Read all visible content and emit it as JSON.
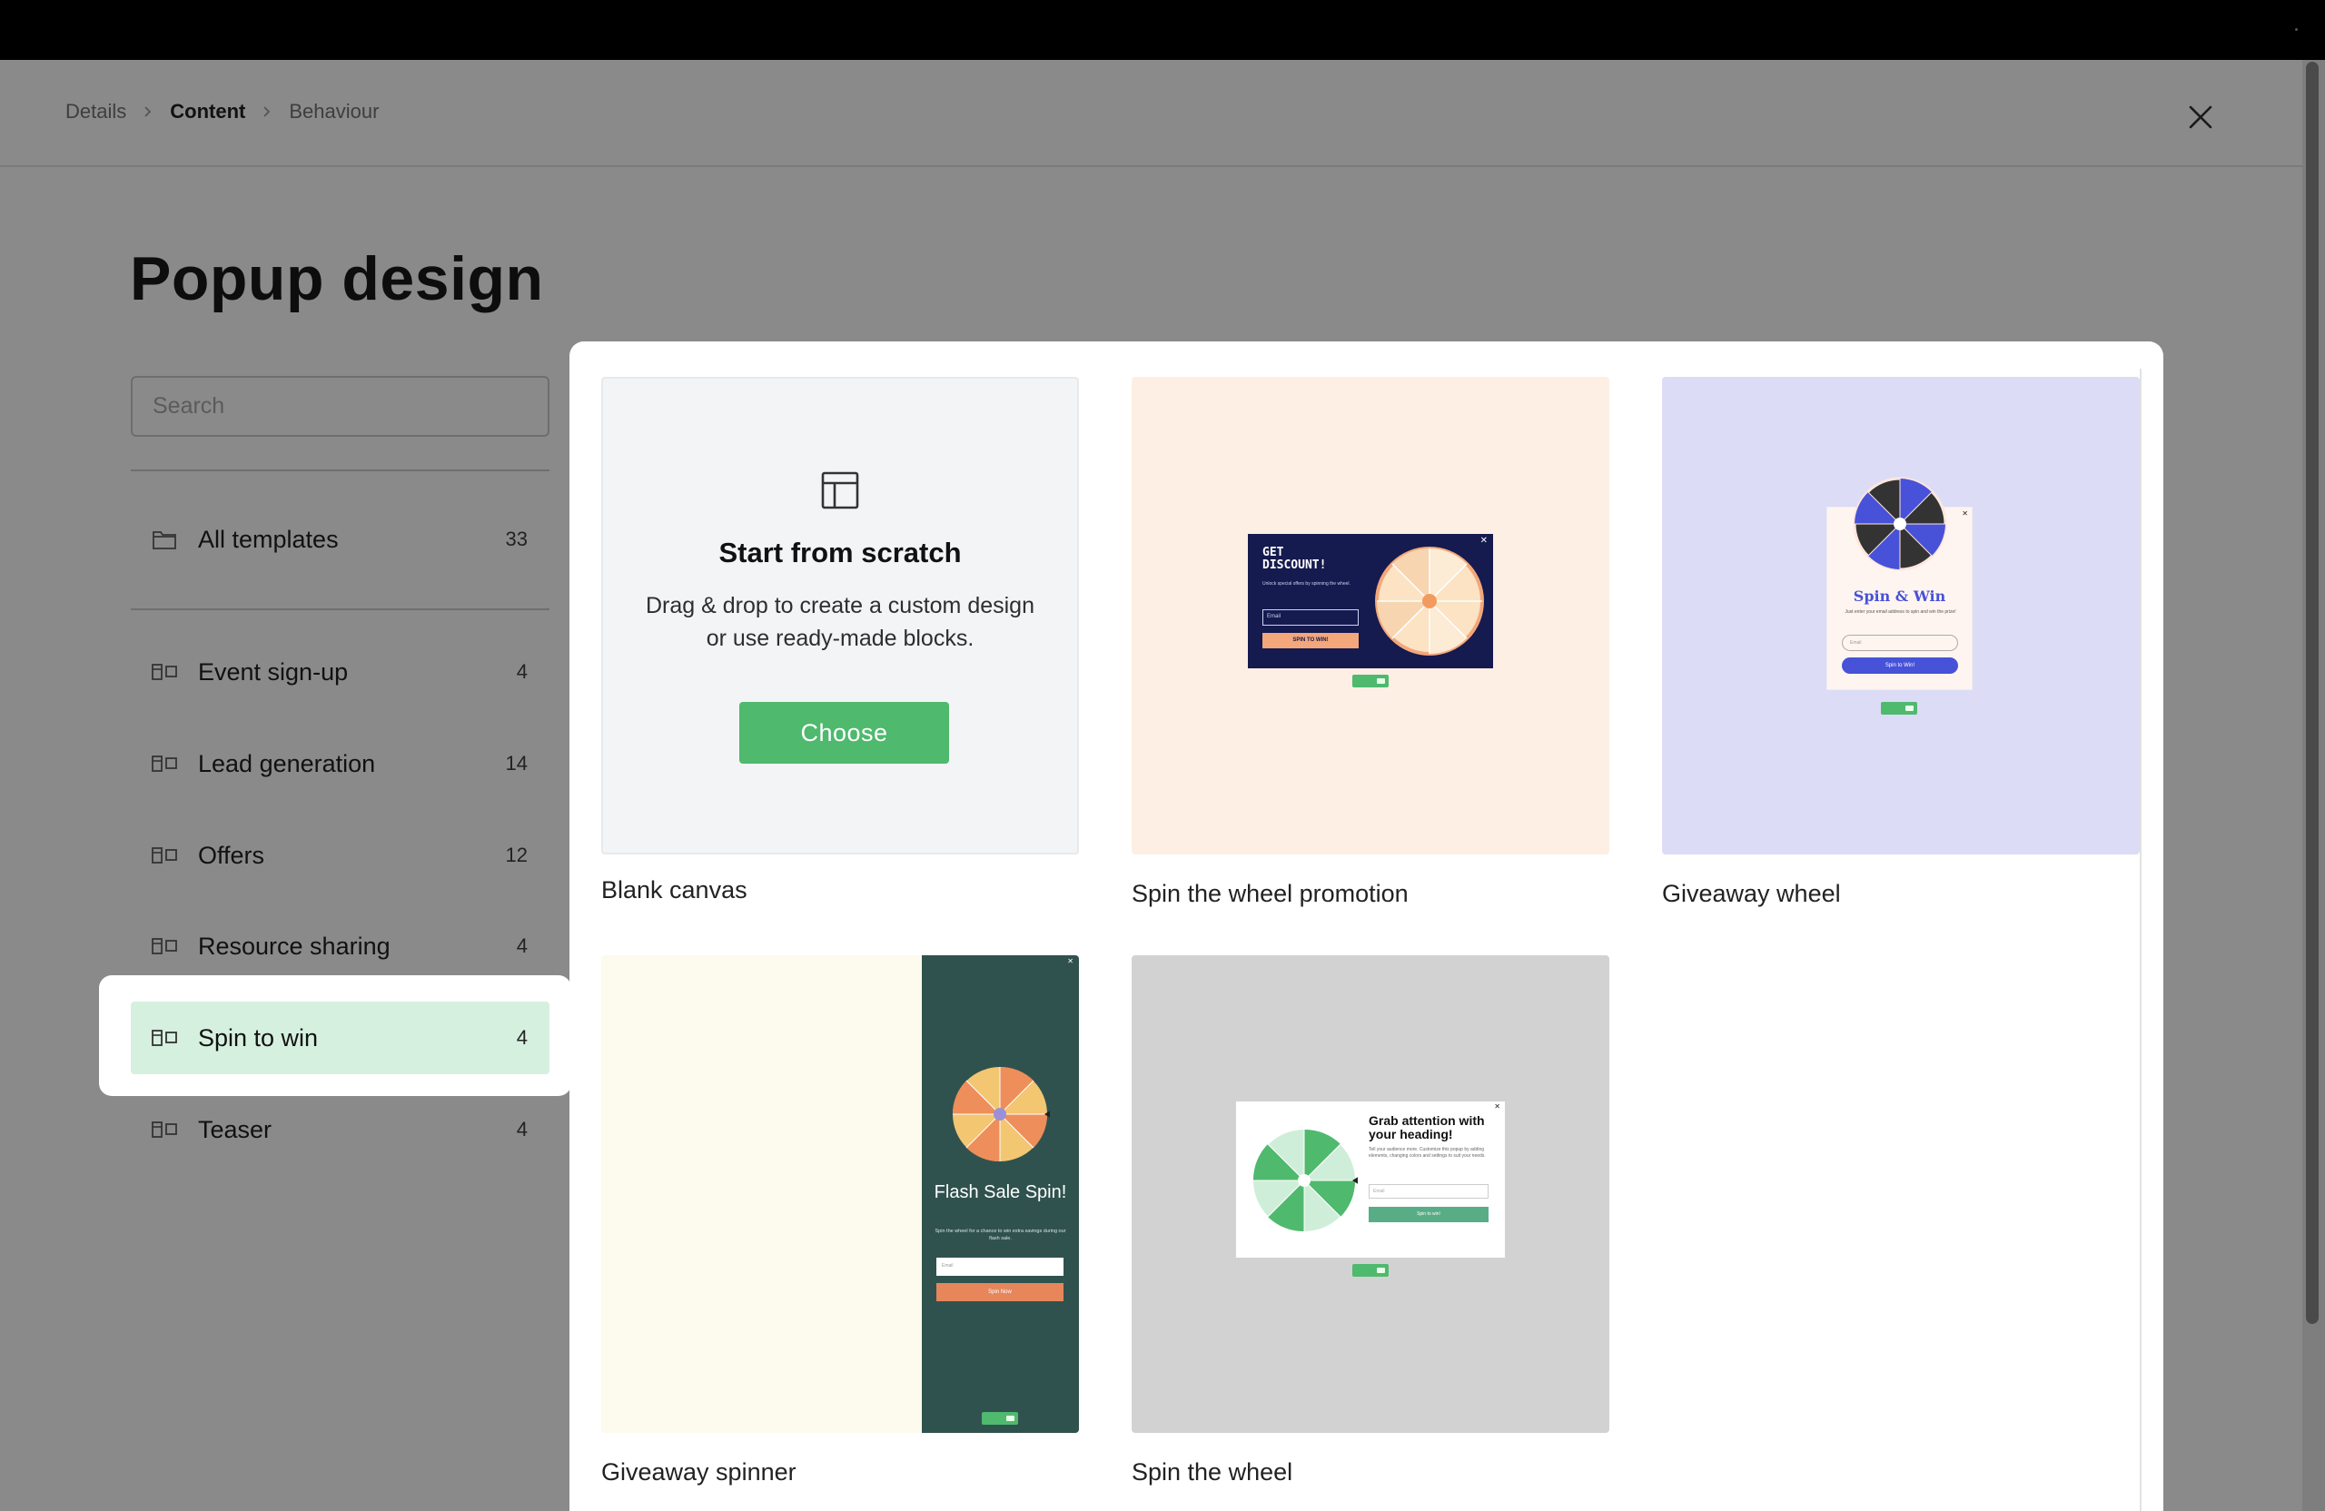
{
  "breadcrumb": {
    "items": [
      {
        "label": "Details",
        "active": false
      },
      {
        "label": "Content",
        "active": true
      },
      {
        "label": "Behaviour",
        "active": false
      }
    ]
  },
  "page": {
    "title": "Popup design"
  },
  "search": {
    "placeholder": "Search",
    "value": ""
  },
  "sidebar": {
    "all": {
      "label": "All templates",
      "count": "33",
      "icon": "folder-icon"
    },
    "categories": [
      {
        "label": "Event sign-up",
        "count": "4",
        "icon": "template-icon"
      },
      {
        "label": "Lead generation",
        "count": "14",
        "icon": "template-icon"
      },
      {
        "label": "Offers",
        "count": "12",
        "icon": "template-icon"
      },
      {
        "label": "Resource sharing",
        "count": "4",
        "icon": "template-icon"
      },
      {
        "label": "Spin to win",
        "count": "4",
        "icon": "template-icon",
        "selected": true
      },
      {
        "label": "Teaser",
        "count": "4",
        "icon": "template-icon"
      }
    ]
  },
  "templates": {
    "blank": {
      "title": "Start from scratch",
      "description": "Drag & drop to create a custom design or use ready-made blocks.",
      "button": "Choose",
      "caption": "Blank canvas"
    },
    "cards": [
      {
        "caption": "Spin the wheel promotion",
        "bg": "#fdefe4",
        "preview": {
          "heading": "GET DISCOUNT!",
          "sub": "Unlock special offers by spinning the wheel.",
          "email": "Email",
          "button": "SPIN TO WIN!"
        }
      },
      {
        "caption": "Giveaway wheel",
        "bg": "#dcdcf7",
        "preview": {
          "heading": "Spin & Win",
          "sub": "Just enter your email address to spin and win the prize!",
          "email": "Email",
          "button": "Spin to Win!"
        }
      },
      {
        "caption": "Giveaway spinner",
        "bg": "#fdfaee",
        "preview": {
          "heading": "Flash Sale Spin!",
          "sub": "Spin the wheel for a chance to win extra savings during our flash sale.",
          "email": "Email",
          "button": "Spin Now"
        }
      },
      {
        "caption": "Spin the wheel",
        "bg": "#d2d2d2",
        "preview": {
          "heading": "Grab attention with your heading!",
          "sub": "Tell your audience more. Customize this popup by adding elements, changing colors and settings to suit your needs.",
          "email": "Email",
          "button": "Spin to win!"
        }
      }
    ]
  },
  "colors": {
    "accent": "#4fb96e",
    "selected_bg": "#d6f0df"
  }
}
